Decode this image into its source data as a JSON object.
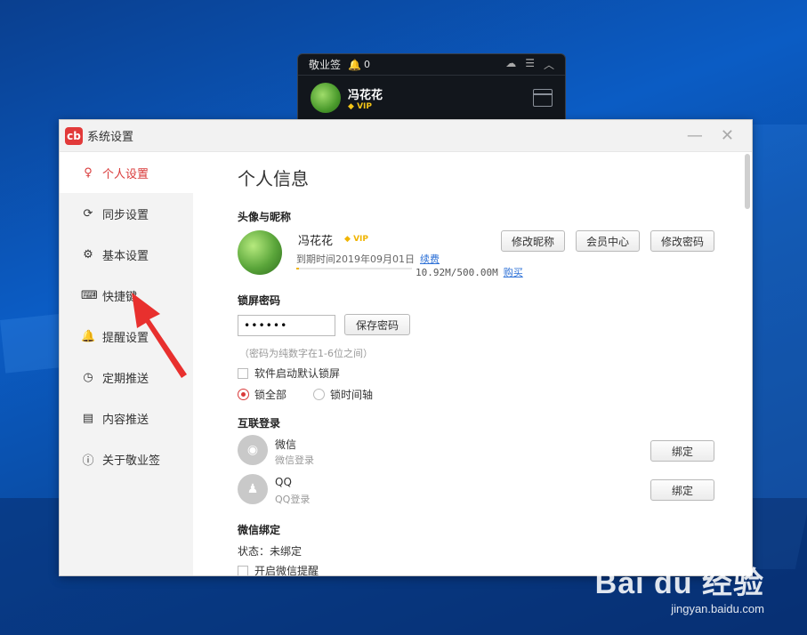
{
  "widget": {
    "title": "敬业签",
    "notif_count": "0",
    "user_name": "冯花花",
    "vip": "VIP"
  },
  "window": {
    "title": "系统设置",
    "logo_glyph": "cb"
  },
  "sidebar": {
    "items": [
      {
        "label": "个人设置",
        "icon": "user-icon",
        "active": true
      },
      {
        "label": "同步设置",
        "icon": "sync-icon"
      },
      {
        "label": "基本设置",
        "icon": "settings-icon"
      },
      {
        "label": "快捷键",
        "icon": "keyboard-icon"
      },
      {
        "label": "提醒设置",
        "icon": "bell-icon"
      },
      {
        "label": "定期推送",
        "icon": "clock-icon"
      },
      {
        "label": "内容推送",
        "icon": "document-icon"
      },
      {
        "label": "关于敬业签",
        "icon": "info-icon"
      }
    ]
  },
  "main": {
    "title": "个人信息",
    "profile": {
      "section": "头像与昵称",
      "name": "冯花花",
      "vip": "VIP",
      "expire": "到期时间2019年09月01日",
      "renew": "续费",
      "storage": "10.92M/500.00M",
      "storage_fraction": 0.02184,
      "buy": "购买",
      "btn_edit_nick": "修改昵称",
      "btn_member": "会员中心",
      "btn_edit_pwd": "修改密码"
    },
    "lock": {
      "section": "锁屏密码",
      "password_mask": "●●●●●●",
      "btn_save": "保存密码",
      "hint": "（密码为纯数字在1-6位之间）",
      "auto_lock": "软件启动默认锁屏",
      "opt_all": "锁全部",
      "opt_timeline": "锁时间轴"
    },
    "social": {
      "section": "互联登录",
      "wechat_name": "微信",
      "wechat_sub": "微信登录",
      "qq_name": "QQ",
      "qq_sub": "QQ登录",
      "bind": "绑定"
    },
    "wechat_bind": {
      "section": "微信绑定",
      "status": "状态：未绑定",
      "remind": "开启微信提醒"
    }
  },
  "watermark": {
    "logo": "Bai du 经验",
    "url": "jingyan.baidu.com"
  },
  "colors": {
    "accent": "#d93a3a",
    "vip": "#f0b400",
    "link": "#2b6fd6",
    "arrow": "#e8302e"
  }
}
